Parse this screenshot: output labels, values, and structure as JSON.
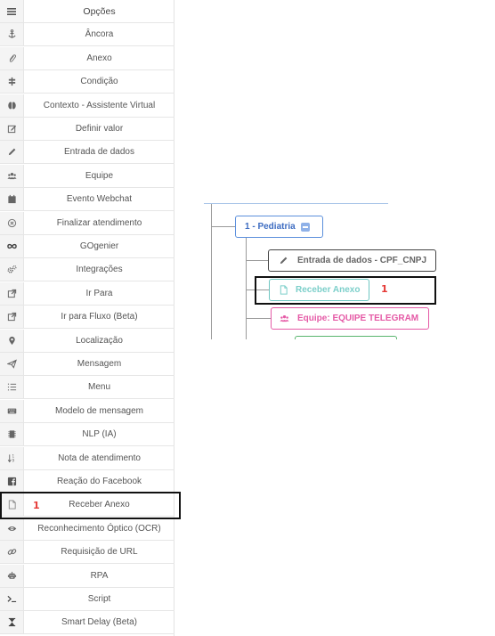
{
  "sidebar": {
    "header": {
      "label": "Opções",
      "icon": "menu-icon"
    },
    "items": [
      {
        "label": "Âncora",
        "icon": "anchor-icon"
      },
      {
        "label": "Anexo",
        "icon": "paperclip-icon"
      },
      {
        "label": "Condição",
        "icon": "signpost-icon"
      },
      {
        "label": "Contexto - Assistente Virtual",
        "icon": "brain-icon"
      },
      {
        "label": "Definir valor",
        "icon": "edit-square-icon"
      },
      {
        "label": "Entrada de dados",
        "icon": "pencil-icon"
      },
      {
        "label": "Equipe",
        "icon": "users-icon"
      },
      {
        "label": "Evento Webchat",
        "icon": "calendar-icon"
      },
      {
        "label": "Finalizar atendimento",
        "icon": "close-circle-icon"
      },
      {
        "label": "GOgenier",
        "icon": "infinity-icon"
      },
      {
        "label": "Integrações",
        "icon": "gears-icon"
      },
      {
        "label": "Ir Para",
        "icon": "external-link-icon"
      },
      {
        "label": "Ir para Fluxo (Beta)",
        "icon": "external-link-icon"
      },
      {
        "label": "Localização",
        "icon": "map-marker-icon"
      },
      {
        "label": "Mensagem",
        "icon": "paper-plane-icon"
      },
      {
        "label": "Menu",
        "icon": "list-ol-icon"
      },
      {
        "label": "Modelo de mensagem",
        "icon": "keyboard-icon"
      },
      {
        "label": "NLP (IA)",
        "icon": "chip-icon"
      },
      {
        "label": "Nota de atendimento",
        "icon": "sort-numeric-icon"
      },
      {
        "label": "Reação do Facebook",
        "icon": "facebook-icon"
      },
      {
        "label": "Receber Anexo",
        "icon": "file-icon"
      },
      {
        "label": "Reconhecimento Óptico (OCR)",
        "icon": "eye-icon"
      },
      {
        "label": "Requisição de URL",
        "icon": "link-icon"
      },
      {
        "label": "RPA",
        "icon": "robot-icon"
      },
      {
        "label": "Script",
        "icon": "terminal-icon"
      },
      {
        "label": "Smart Delay (Beta)",
        "icon": "hourglass-icon"
      }
    ],
    "annotation_marker": "1"
  },
  "canvas": {
    "nodes": [
      {
        "label": "1 - Pediatria",
        "icon": "collapse-minus-icon",
        "color": "#3d6cc1"
      },
      {
        "label": "Entrada de dados - CPF_CNPJ",
        "icon": "pencil-icon",
        "color": "#666666"
      },
      {
        "label": "Receber Anexo",
        "icon": "file-icon",
        "color": "#7ccfca"
      },
      {
        "label": "Equipe: EQUIPE TELEGRAM",
        "icon": "users-icon",
        "color": "#e55aa6"
      }
    ],
    "annotation_marker": "1"
  },
  "colors": {
    "highlight_border": "#111111",
    "marker": "#e53935"
  }
}
